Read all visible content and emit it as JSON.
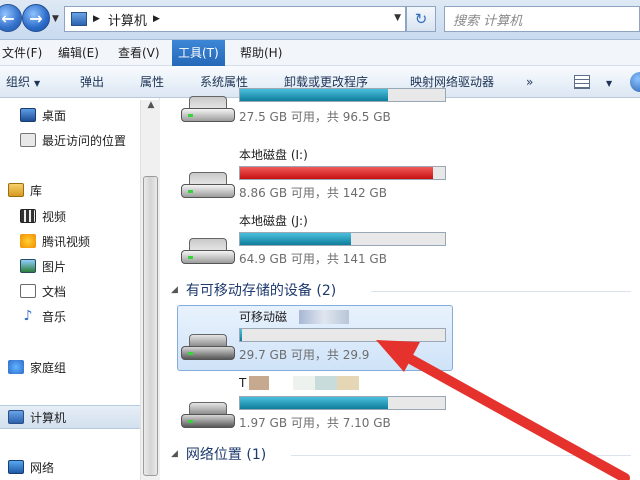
{
  "address": {
    "path": "计算机",
    "search_placeholder": "搜索 计算机"
  },
  "menu": [
    {
      "label": "文件(F)"
    },
    {
      "label": "编辑(E)"
    },
    {
      "label": "查看(V)"
    },
    {
      "label": "工具(T)",
      "active": true
    },
    {
      "label": "帮助(H)"
    }
  ],
  "toolbar": {
    "organize": "组织",
    "eject": "弹出",
    "properties": "属性",
    "system_properties": "系统属性",
    "uninstall": "卸载或更改程序",
    "map_drive": "映射网络驱动器",
    "more": "»"
  },
  "sidebar": {
    "desktop": "桌面",
    "recent": "最近访问的位置",
    "library": "库",
    "video": "视频",
    "tencent_video": "腾讯视频",
    "pictures": "图片",
    "documents": "文档",
    "music": "音乐",
    "homegroup": "家庭组",
    "computer": "计算机",
    "network": "网络"
  },
  "drives": {
    "drive_top": {
      "size": "27.5 GB 可用，共 96.5 GB",
      "used_fraction": 0.72
    },
    "drive_i": {
      "label": "本地磁盘 (I:)",
      "size": "8.86 GB 可用，共 142 GB",
      "used_fraction": 0.94
    },
    "drive_j": {
      "label": "本地磁盘 (J:)",
      "size": "64.9 GB 可用，共 141 GB",
      "used_fraction": 0.54
    }
  },
  "groups": {
    "removable": "有可移动存储的设备 (2)",
    "network": "网络位置 (1)"
  },
  "removable": {
    "usb1": {
      "label": "可移动磁",
      "size": "29.7 GB 可用，共 29.9",
      "used_fraction": 0.01
    },
    "usb2": {
      "label": "T",
      "size": "1.97 GB 可用，共 7.10 GB",
      "used_fraction": 0.72
    }
  },
  "colors": {
    "accent": "#2568b8",
    "bar_normal": "#1a8cb0",
    "bar_full": "#d61c1c",
    "arrow": "#e5322d"
  }
}
